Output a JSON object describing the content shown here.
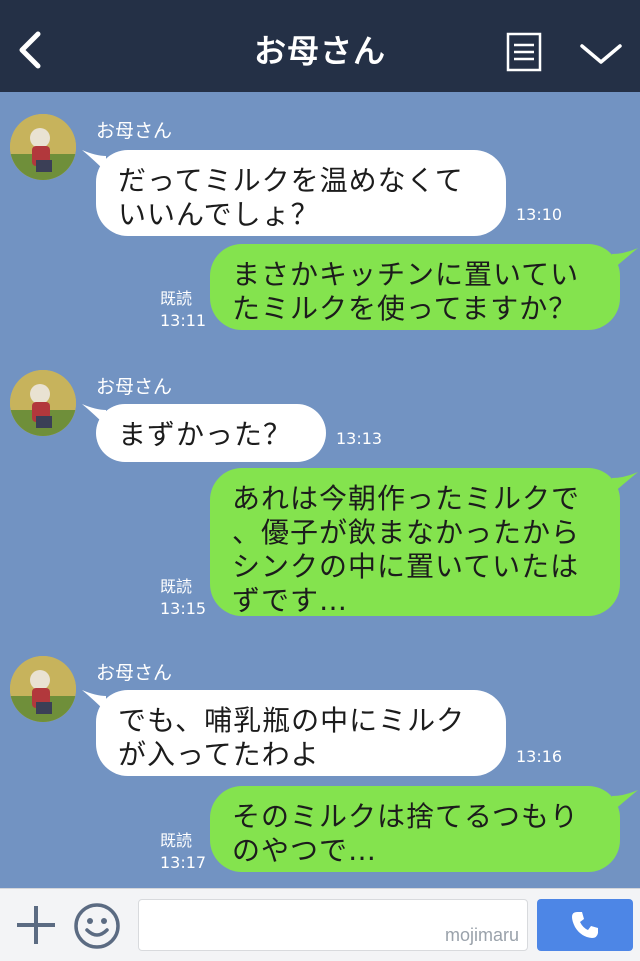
{
  "header": {
    "title": "お母さん"
  },
  "messages": [
    {
      "type": "in",
      "sender": "お母さん",
      "text": "だってミルクを温めなくて\nいいんでしょ？",
      "time": "13:10"
    },
    {
      "type": "out",
      "read": "既読",
      "text": "まさかキッチンに置いてい\nたミルクを使ってますか？",
      "time": "13:11"
    },
    {
      "type": "in",
      "sender": "お母さん",
      "text": "まずかった？",
      "time": "13:13"
    },
    {
      "type": "out",
      "read": "既読",
      "text": "あれは今朝作ったミルクで\n、優子が飲まなかったから\nシンクの中に置いていたは\nずです…",
      "time": "13:15"
    },
    {
      "type": "in",
      "sender": "お母さん",
      "text": "でも、哺乳瓶の中にミルク\nが入ってたわよ",
      "time": "13:16"
    },
    {
      "type": "out",
      "read": "既読",
      "text": "そのミルクは捨てるつもり\nのやつで…",
      "time": "13:17"
    }
  ],
  "footer": {
    "watermark": "mojimaru"
  }
}
